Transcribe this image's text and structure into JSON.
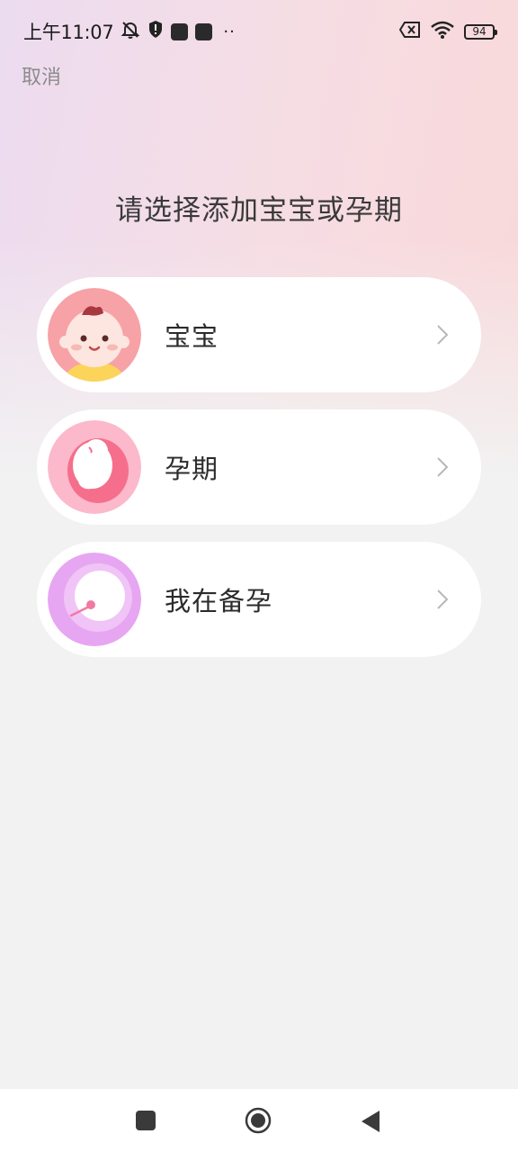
{
  "status_bar": {
    "time": "上午11:07",
    "battery_level": "94",
    "icons": [
      "mute-bell-icon",
      "shield-icon",
      "app-icon",
      "app-icon",
      "more-dots-icon",
      "sim-off-icon",
      "wifi-icon",
      "battery-icon"
    ]
  },
  "header": {
    "cancel_label": "取消",
    "title": "请选择添加宝宝或孕期"
  },
  "options": [
    {
      "label": "宝宝",
      "icon": "baby-face-icon",
      "accent": "#f7a2a6"
    },
    {
      "label": "孕期",
      "icon": "fetus-icon",
      "accent": "#f56f8c"
    },
    {
      "label": "我在备孕",
      "icon": "egg-sperm-icon",
      "accent": "#e7a6f1"
    }
  ],
  "nav_bar": {
    "buttons": [
      "recent-apps-icon",
      "home-icon",
      "back-icon"
    ]
  },
  "colors": {
    "background": "#f2f2f2",
    "card": "#ffffff",
    "title_text": "#3a3a3a",
    "cancel_text": "#8c8c8c",
    "chevron": "#b8b8b8"
  }
}
